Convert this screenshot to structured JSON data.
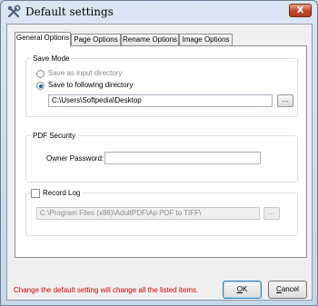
{
  "window": {
    "title": "Default settings",
    "close_label": "X",
    "icon": "tools-icon"
  },
  "tabs": [
    {
      "label": "General Options",
      "active": true
    },
    {
      "label": "Page Options",
      "active": false
    },
    {
      "label": "Rename Options",
      "active": false
    },
    {
      "label": "Image Options",
      "active": false
    }
  ],
  "save_mode": {
    "legend": "Save Mode",
    "option_input_dir": "Save as input directory",
    "option_following_dir": "Save to following directory",
    "selected": "option_following_dir",
    "directory_value": "C:\\Users\\Softpedia\\Desktop",
    "browse_label": "..."
  },
  "pdf_security": {
    "legend": "PDF Security",
    "owner_password_label": "Owner Password:",
    "owner_password_value": ""
  },
  "record_log": {
    "legend": "Record Log",
    "checked": false,
    "path_value": "C:\\Program Files (x86)\\AdultPDF\\Ap PDF to TIFF\\",
    "browse_label": "..."
  },
  "footer": {
    "note": "Change the default setting will change all the listed items.",
    "ok_key": "O",
    "ok_rest": "K",
    "cancel_key": "C",
    "cancel_rest": "ancel"
  },
  "colors": {
    "note_color": "#d00000",
    "radio_accent": "#1d5fc7"
  }
}
